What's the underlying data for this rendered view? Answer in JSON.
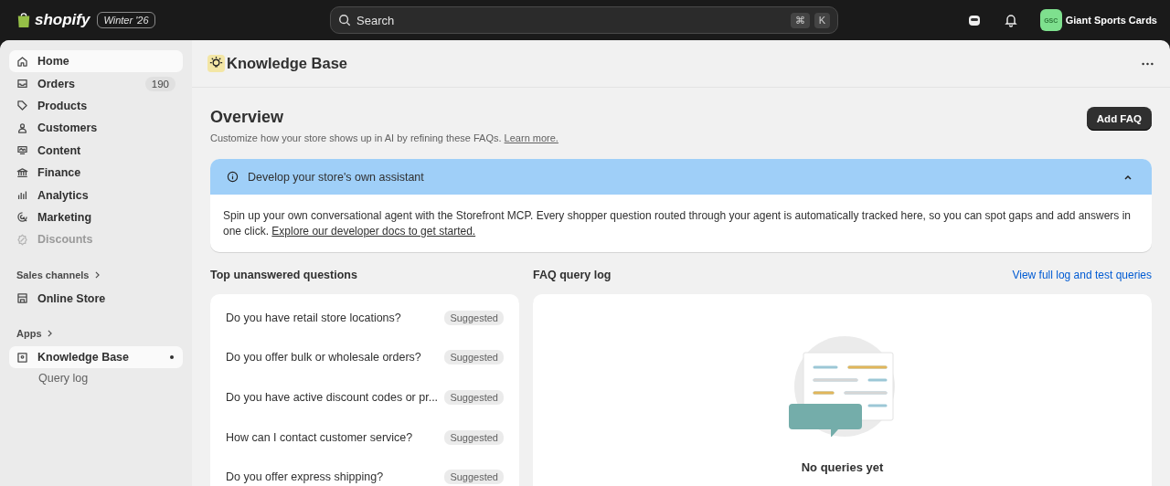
{
  "topbar": {
    "logo_text": "shopify",
    "edition": "Winter '26",
    "search": {
      "placeholder": "Search",
      "keys": [
        "⌘",
        "K"
      ]
    },
    "store": {
      "initials": "GSC",
      "name": "Giant Sports Cards"
    }
  },
  "sidebar": {
    "items": [
      {
        "label": "Home",
        "selected": true,
        "disabled": false
      },
      {
        "label": "Orders",
        "selected": false,
        "disabled": false,
        "badge": "190"
      },
      {
        "label": "Products",
        "selected": false,
        "disabled": false
      },
      {
        "label": "Customers",
        "selected": false,
        "disabled": false
      },
      {
        "label": "Content",
        "selected": false,
        "disabled": false
      },
      {
        "label": "Finance",
        "selected": false,
        "disabled": false
      },
      {
        "label": "Analytics",
        "selected": false,
        "disabled": false
      },
      {
        "label": "Marketing",
        "selected": false,
        "disabled": false
      },
      {
        "label": "Discounts",
        "selected": false,
        "disabled": true
      }
    ],
    "sections": [
      {
        "title": "Sales channels",
        "items": [
          {
            "label": "Online Store",
            "selected": false,
            "disabled": false
          }
        ]
      },
      {
        "title": "Apps",
        "items": [
          {
            "label": "Knowledge Base",
            "selected": true,
            "disabled": false,
            "unread": true,
            "children": [
              {
                "label": "Query log",
                "selected": false
              }
            ]
          }
        ]
      }
    ]
  },
  "page": {
    "title": "Knowledge Base",
    "overview": {
      "title": "Overview",
      "description": "Customize how your store shows up in AI by refining these FAQs.",
      "link": "Learn more.",
      "button": "Add FAQ"
    },
    "banner": {
      "title": "Develop your store's own assistant",
      "expanded": true,
      "body": "Spin up your own conversational agent with the Storefront MCP. Every shopper question routed through your agent is automatically tracked here, so you can spot gaps and add answers in one click.",
      "link": "Explore our developer docs to get started."
    },
    "unanswered": {
      "title": "Top unanswered questions",
      "questions": [
        {
          "text": "Do you have retail store locations?",
          "badge": "Suggested"
        },
        {
          "text": "Do you offer bulk or wholesale orders?",
          "badge": "Suggested"
        },
        {
          "text": "Do you have active discount codes or pr...",
          "badge": "Suggested"
        },
        {
          "text": "How can I contact customer service?",
          "badge": "Suggested"
        },
        {
          "text": "Do you offer express shipping?",
          "badge": "Suggested"
        }
      ]
    },
    "query_log": {
      "title": "FAQ query log",
      "link": "View full log and test queries",
      "empty_title": "No queries yet"
    }
  }
}
